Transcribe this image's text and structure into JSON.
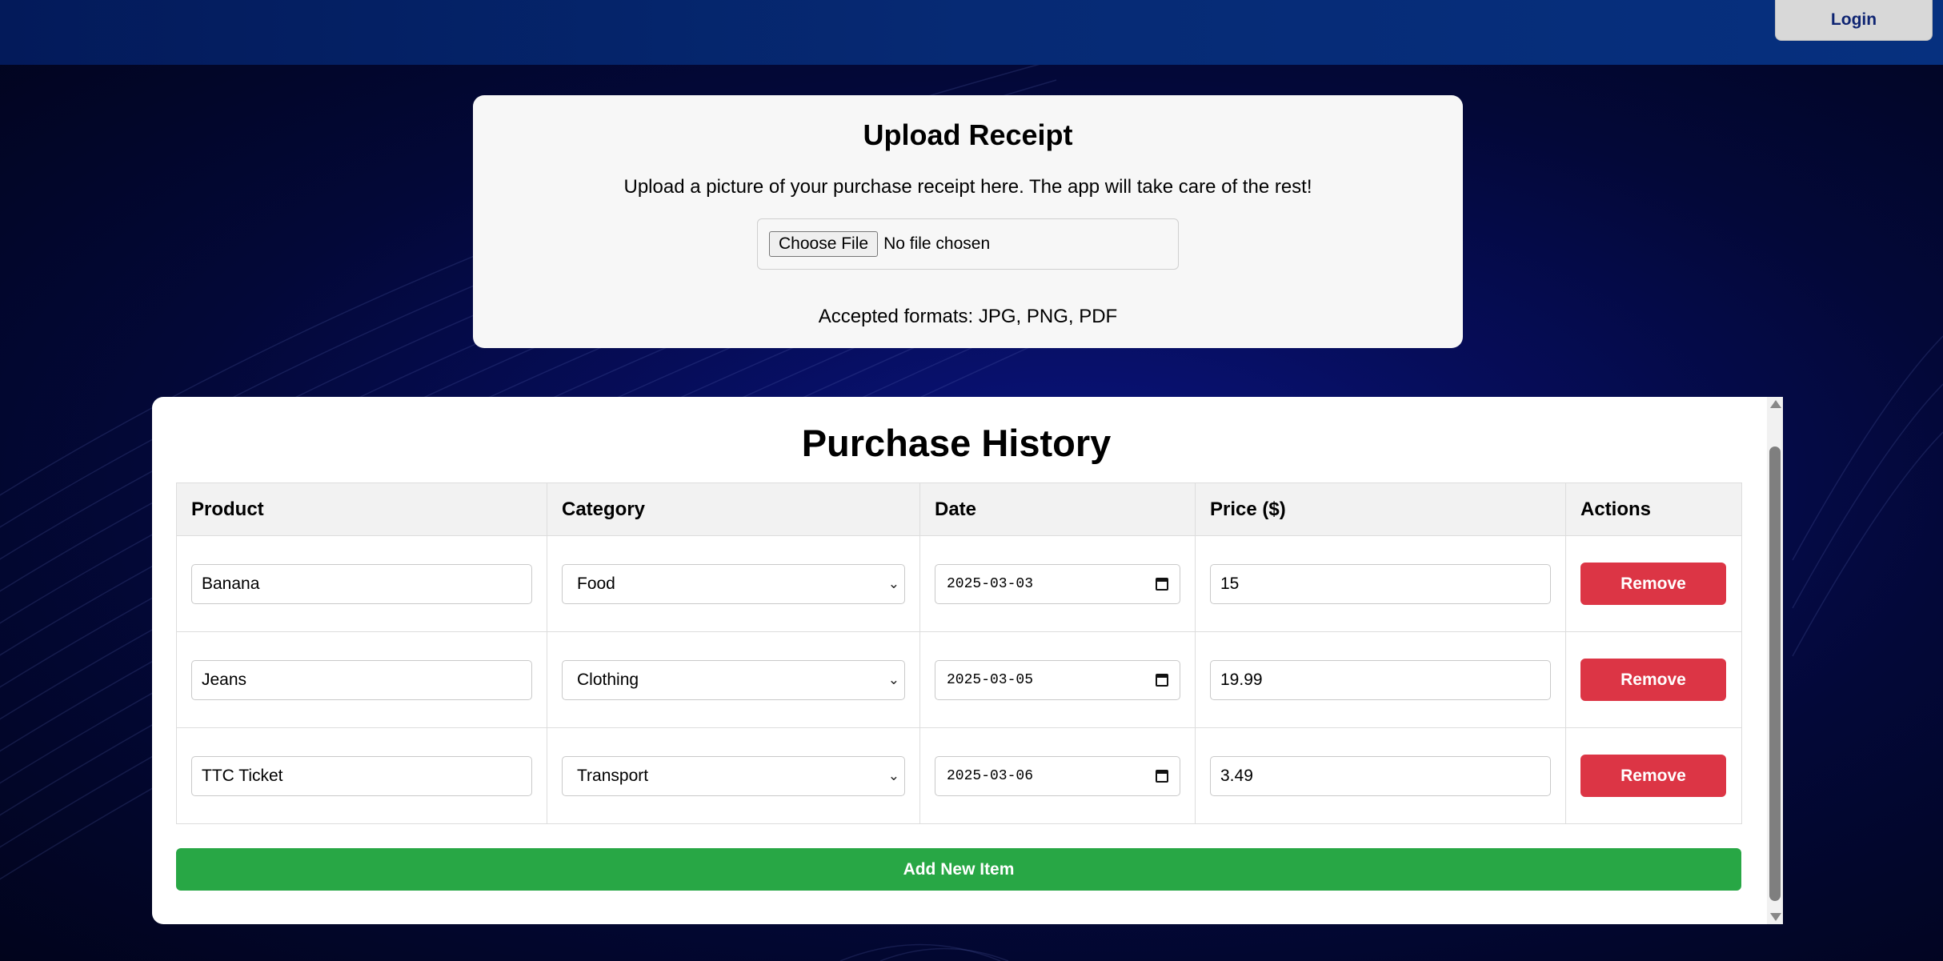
{
  "header": {
    "login_label": "Login"
  },
  "upload": {
    "title": "Upload Receipt",
    "description": "Upload a picture of your purchase receipt here. The app will take care of the rest!",
    "choose_file_label": "Choose File",
    "file_status": "No file chosen",
    "formats": "Accepted formats: JPG, PNG, PDF"
  },
  "history": {
    "title": "Purchase History",
    "columns": [
      "Product",
      "Category",
      "Date",
      "Price ($)",
      "Actions"
    ],
    "rows": [
      {
        "product": "Banana",
        "category": "Food",
        "date": "2025-03-03",
        "price": "15",
        "action": "Remove"
      },
      {
        "product": "Jeans",
        "category": "Clothing",
        "date": "2025-03-05",
        "price": "19.99",
        "action": "Remove"
      },
      {
        "product": "TTC Ticket",
        "category": "Transport",
        "date": "2025-03-06",
        "price": "3.49",
        "action": "Remove"
      }
    ],
    "add_label": "Add New Item"
  },
  "colors": {
    "topbar": "#06307f",
    "remove": "#dc3545",
    "add": "#28a745",
    "background": "#030838"
  },
  "icons": [
    "chevron-down-icon",
    "calendar-icon",
    "scroll-up-arrow-icon",
    "scroll-down-arrow-icon"
  ]
}
